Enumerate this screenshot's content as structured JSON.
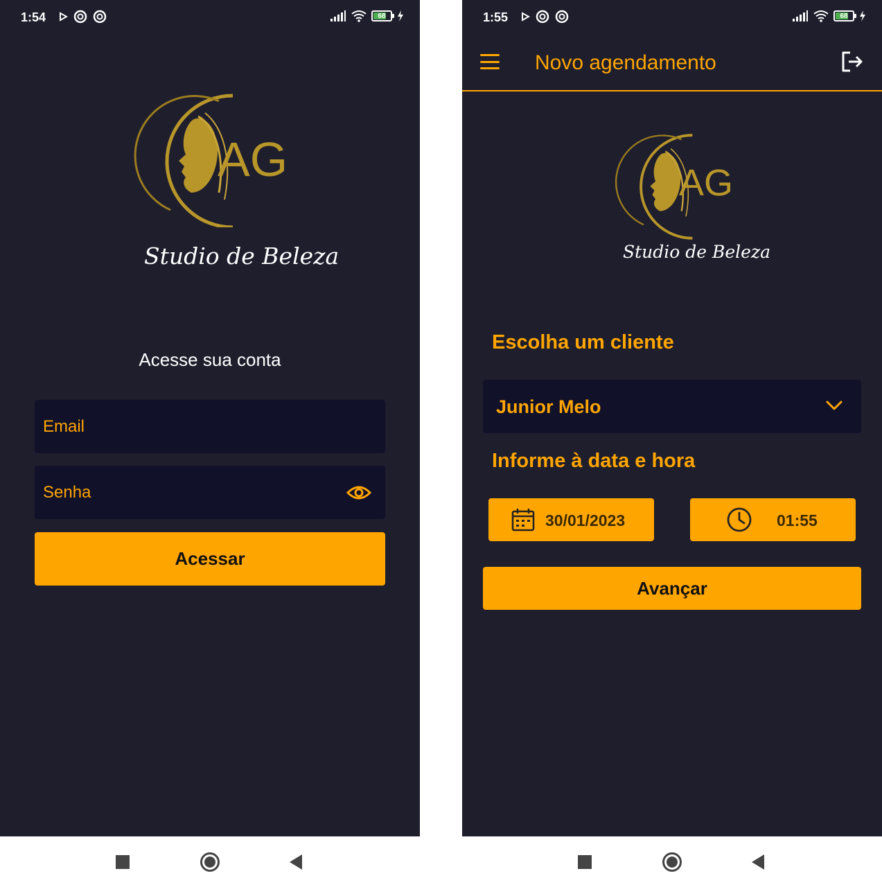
{
  "login_screen": {
    "status_bar": {
      "time": "1:54",
      "battery": "68"
    },
    "logo": {
      "monogram": "AG",
      "text": "Studio de Beleza"
    },
    "heading": "Acesse sua conta",
    "email_placeholder": "Email",
    "password_placeholder": "Senha",
    "submit_label": "Acessar"
  },
  "booking_screen": {
    "status_bar": {
      "time": "1:55",
      "battery": "68"
    },
    "app_bar": {
      "title": "Novo agendamento"
    },
    "logo": {
      "monogram": "AG",
      "text": "Studio de Beleza"
    },
    "client_section_title": "Escolha um cliente",
    "selected_client": "Junior Melo",
    "datetime_section_title": "Informe à data e hora",
    "date_value": "30/01/2023",
    "time_value": "01:55",
    "next_label": "Avançar"
  },
  "colors": {
    "background": "#1e1e2d",
    "field": "#11112a",
    "accent": "#ffa500",
    "gold": "#b8962a"
  }
}
